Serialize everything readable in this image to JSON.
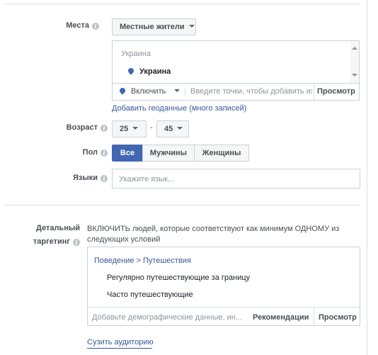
{
  "places": {
    "label": "Места",
    "dropdown": "Местные жители",
    "box_header": "Украина",
    "selected": "Украина",
    "include_label": "Включить",
    "input_placeholder": "Введите точки, чтобы добавить их",
    "browse": "Просмотр",
    "bulk_link": "Добавить геоданные (много записей)"
  },
  "age": {
    "label": "Возраст",
    "min": "25",
    "dash": "-",
    "max": "45"
  },
  "gender": {
    "label": "Пол",
    "all": "Все",
    "men": "Мужчины",
    "women": "Женщины"
  },
  "languages": {
    "label": "Языки",
    "placeholder": "Укажите язык..."
  },
  "detailed": {
    "label_line1": "Детальный",
    "label_line2": "таргетинг",
    "description": "ВКЛЮЧИТЬ людей, которые соответствуют как минимум ОДНОМУ из следующих условий",
    "category": "Поведение > Путешествия",
    "items": [
      "Регулярно путешествующие за границу",
      "Часто путешествующие"
    ],
    "input_placeholder": "Добавьте демографические данные, ин...",
    "recommendations": "Рекомендации",
    "browse": "Просмотр",
    "narrow_link": "Сузить аудиторию"
  },
  "colors": {
    "accent": "#4267b2",
    "link": "#365899",
    "border": "#ccd0d5"
  }
}
